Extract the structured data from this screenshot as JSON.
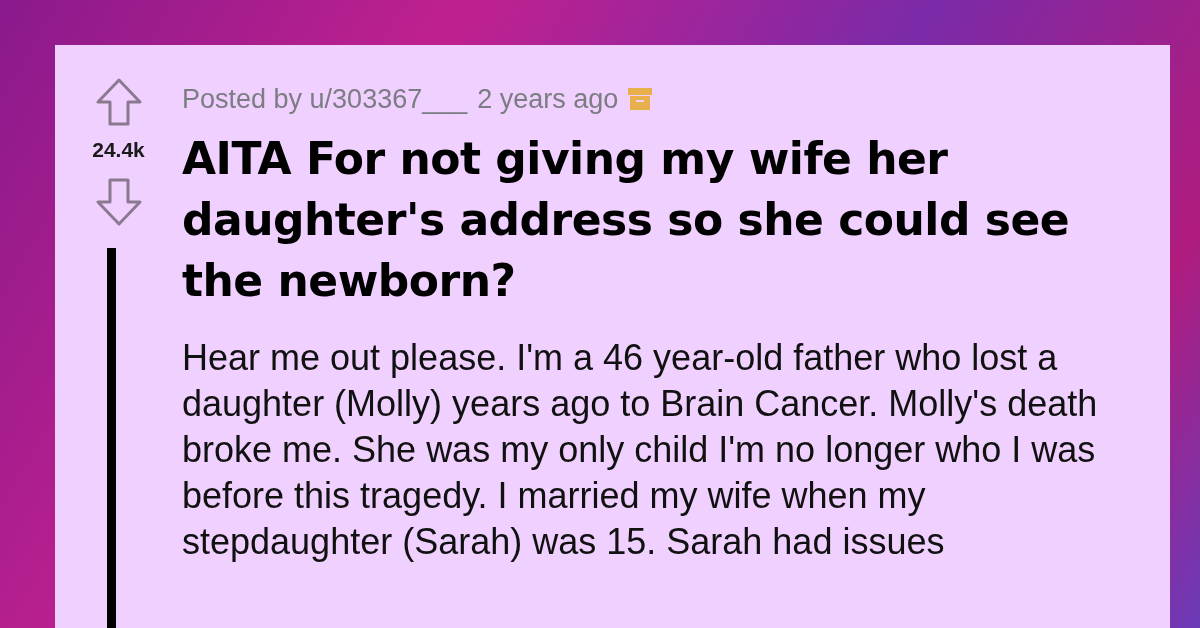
{
  "post": {
    "posted_by": "Posted by u/303367___",
    "age": "2 years ago",
    "archived": true,
    "score": "24.4k",
    "title": "AITA For not giving my wife her daughter's address so she could see the newborn?",
    "body": "Hear me out please. I'm a 46 year-old father who lost a daughter (Molly) years ago to Brain Cancer. Molly's death broke me. She was my only child I'm no longer who I was before this tragedy. I married my wife when my stepdaughter (Sarah) was 15. Sarah had issues"
  }
}
